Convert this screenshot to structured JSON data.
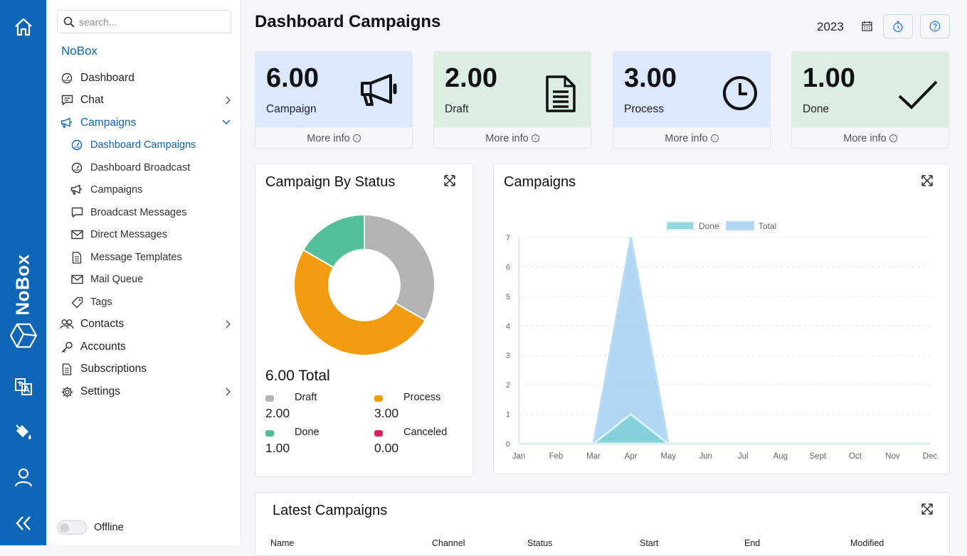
{
  "rail": {
    "brand": "NoBox",
    "icons": [
      "home-icon",
      "nobox-logo-icon",
      "translate-icon",
      "paint-bucket-icon",
      "user-icon",
      "collapse-icon"
    ]
  },
  "sidebar": {
    "search_placeholder": "search...",
    "app_name": "NoBox",
    "items": [
      {
        "label": "Dashboard",
        "icon": "gauge-icon"
      },
      {
        "label": "Chat",
        "icon": "chat-icon"
      },
      {
        "label": "Campaigns",
        "icon": "megaphone-icon"
      },
      {
        "label": "Dashboard Campaigns",
        "icon": "gauge-icon"
      },
      {
        "label": "Dashboard Broadcast",
        "icon": "gauge-icon"
      },
      {
        "label": "Campaigns",
        "icon": "megaphone-icon"
      },
      {
        "label": "Broadcast Messages",
        "icon": "message-icon"
      },
      {
        "label": "Direct Messages",
        "icon": "mail-icon"
      },
      {
        "label": "Message Templates",
        "icon": "document-icon"
      },
      {
        "label": "Mail Queue",
        "icon": "mail-icon"
      },
      {
        "label": "Tags",
        "icon": "tag-icon"
      },
      {
        "label": "Contacts",
        "icon": "users-icon"
      },
      {
        "label": "Accounts",
        "icon": "key-icon"
      },
      {
        "label": "Subscriptions",
        "icon": "document-icon"
      },
      {
        "label": "Settings",
        "icon": "gear-icon"
      }
    ],
    "status_label": "Offline"
  },
  "header": {
    "title": "Dashboard Campaigns",
    "year": "2023"
  },
  "cards": [
    {
      "value": "6.00",
      "label": "Campaign",
      "more": "More info",
      "color": "#dbe8fd",
      "icon": "megaphone-icon"
    },
    {
      "value": "2.00",
      "label": "Draft",
      "more": "More info",
      "color": "#dcede2",
      "icon": "document-icon"
    },
    {
      "value": "3.00",
      "label": "Process",
      "more": "More info",
      "color": "#dbe8fd",
      "icon": "clock-icon"
    },
    {
      "value": "1.00",
      "label": "Done",
      "more": "More info",
      "color": "#dcede2",
      "icon": "check-icon"
    }
  ],
  "status_panel": {
    "title": "Campaign By Status",
    "total": "6.00 Total",
    "legend": [
      {
        "name": "Draft",
        "value": "2.00",
        "color": "#b3b3b3"
      },
      {
        "name": "Process",
        "value": "3.00",
        "color": "#f29c12"
      },
      {
        "name": "Done",
        "value": "1.00",
        "color": "#52be9a"
      },
      {
        "name": "Canceled",
        "value": "0.00",
        "color": "#d8245a"
      }
    ]
  },
  "campaigns_panel": {
    "title": "Campaigns"
  },
  "latest_panel": {
    "title": "Latest Campaigns",
    "columns": [
      "Name",
      "Channel",
      "Status",
      "Start",
      "End",
      "Modified"
    ]
  },
  "chart_data": [
    {
      "type": "pie",
      "categories": [
        "Draft",
        "Process",
        "Done",
        "Canceled"
      ],
      "values": [
        2,
        3,
        1,
        0
      ],
      "colors": [
        "#b3b3b3",
        "#f29c12",
        "#52be9a",
        "#d8245a"
      ],
      "title": "Campaign By Status"
    },
    {
      "type": "area",
      "title": "Campaigns",
      "categories": [
        "Jan",
        "Feb",
        "Mar",
        "Apr",
        "May",
        "Jun",
        "Jul",
        "Aug",
        "Sept",
        "Oct",
        "Nov",
        "Dec"
      ],
      "series": [
        {
          "name": "Done",
          "values": [
            0,
            0,
            0,
            1,
            0,
            0,
            0,
            0,
            0,
            0,
            0,
            0
          ],
          "color": "#7ecfd6"
        },
        {
          "name": "Total",
          "values": [
            0,
            0,
            0,
            7,
            0,
            0,
            0,
            0,
            0,
            0,
            0,
            0
          ],
          "color": "#a8d4f5"
        }
      ],
      "ylim": [
        0,
        7
      ],
      "yticks": [
        "0",
        "1",
        "2",
        "3",
        "4",
        "5",
        "6",
        "7"
      ],
      "legend": "top",
      "grid": true
    }
  ]
}
